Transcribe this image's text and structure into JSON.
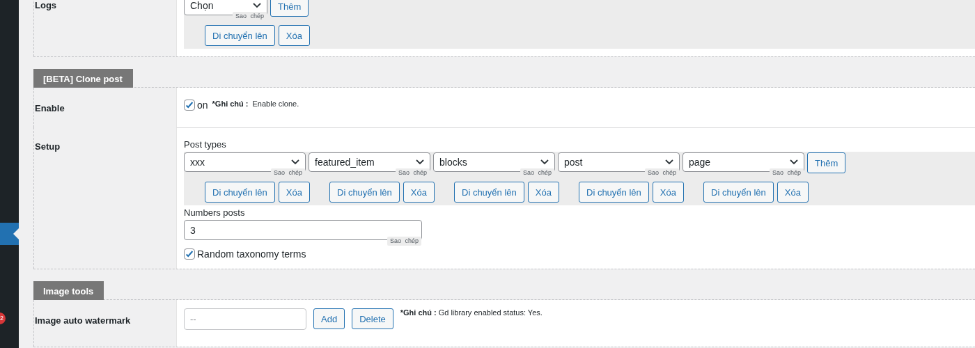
{
  "sidebar": {
    "badge": "2"
  },
  "sections": [
    {
      "rows": [
        {
          "label": "Logs",
          "fields": [
            {
              "kind": "repeater",
              "items": [
                {
                  "value": "Chọn",
                  "copy": "Sao chép",
                  "move": "Di chuyển lên",
                  "delete": "Xóa"
                }
              ],
              "add": "Thêm"
            }
          ]
        }
      ]
    },
    {
      "title": "[BETA] Clone post",
      "rows": [
        {
          "label": "Enable",
          "fields": [
            {
              "kind": "checkbox",
              "checked": true,
              "text": "on",
              "note_label": "*Ghi chú :",
              "note": "Enable clone."
            }
          ]
        },
        {
          "label": "Setup",
          "fields": [
            {
              "kind": "repeater",
              "caption": "Post types",
              "items": [
                {
                  "value": "xxx",
                  "copy": "Sao chép",
                  "move": "Di chuyển lên",
                  "delete": "Xóa"
                },
                {
                  "value": "featured_item",
                  "copy": "Sao chép",
                  "move": "Di chuyển lên",
                  "delete": "Xóa"
                },
                {
                  "value": "blocks",
                  "copy": "Sao chép",
                  "move": "Di chuyển lên",
                  "delete": "Xóa"
                },
                {
                  "value": "post",
                  "copy": "Sao chép",
                  "move": "Di chuyển lên",
                  "delete": "Xóa"
                },
                {
                  "value": "page",
                  "copy": "Sao chép",
                  "move": "Di chuyển lên",
                  "delete": "Xóa"
                }
              ],
              "add": "Thêm"
            },
            {
              "kind": "text",
              "caption": "Numbers posts",
              "value": "3",
              "copy": "Sao chép"
            },
            {
              "kind": "checkbox",
              "checked": true,
              "text": "Random taxonomy terms"
            }
          ]
        }
      ]
    },
    {
      "title": "Image tools",
      "rows": [
        {
          "label": "Image auto watermark",
          "fields": [
            {
              "kind": "media",
              "placeholder": "--",
              "buttons": [
                "Add",
                "Delete"
              ],
              "note_label": "*Ghi chú :",
              "note": "Gd library enabled status: Yes."
            }
          ]
        }
      ]
    }
  ]
}
